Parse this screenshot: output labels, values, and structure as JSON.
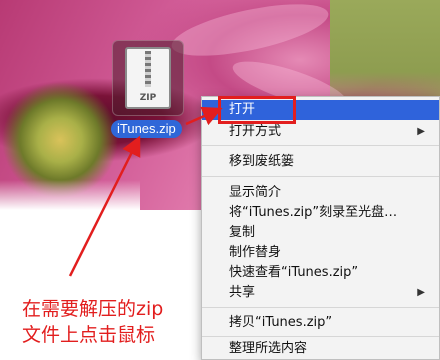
{
  "desktop": {
    "file": {
      "icon_text": "ZIP",
      "label": "iTunes.zip"
    }
  },
  "annotation": {
    "line1": "在需要解压的zip",
    "line2": "文件上点击鼠标",
    "color": "#e21e1e"
  },
  "context_menu": {
    "open": "打开",
    "open_with": "打开方式",
    "move_to_trash": "移到废纸篓",
    "get_info": "显示简介",
    "burn": "将“iTunes.zip”刻录至光盘…",
    "copy": "复制",
    "make_alias": "制作替身",
    "quick_look": "快速查看“iTunes.zip”",
    "share": "共享",
    "copy_item": "拷贝“iTunes.zip”",
    "clean_up": "整理所选内容",
    "submenu_glyph": "▶",
    "highlight_color": "#2f63db"
  }
}
